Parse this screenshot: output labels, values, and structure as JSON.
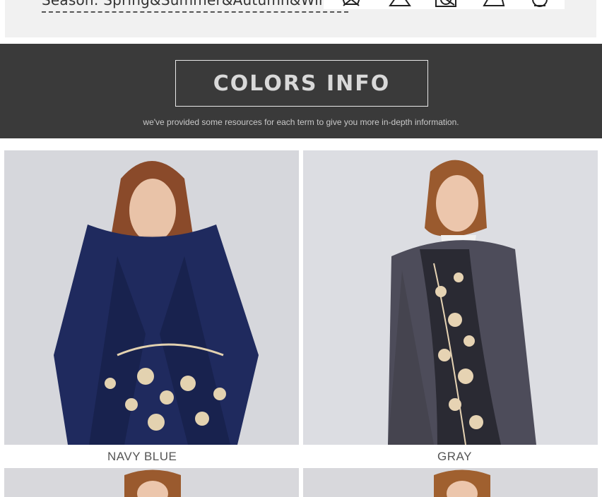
{
  "previous_section": {
    "season_text": "Season: Spring&Summer&Autumn&Winter",
    "care_icons": [
      "do-not-wash-icon",
      "do-not-bleach-icon",
      "do-not-tumble-dry-icon",
      "do-not-iron-icon",
      "dry-clean-icon"
    ]
  },
  "banner": {
    "title": "COLORS INFO",
    "subtitle": "we've provided some resources for each term to give you more in-depth information."
  },
  "colors": [
    {
      "label": "NAVY BLUE",
      "swatch": "#1e2a5c"
    },
    {
      "label": "GRAY",
      "swatch": "#4d4c5a"
    }
  ],
  "palette": {
    "banner_bg": "#3a3a3a",
    "photo_bg": "#d7d8dd",
    "embroidery": "#e6d3b3"
  }
}
